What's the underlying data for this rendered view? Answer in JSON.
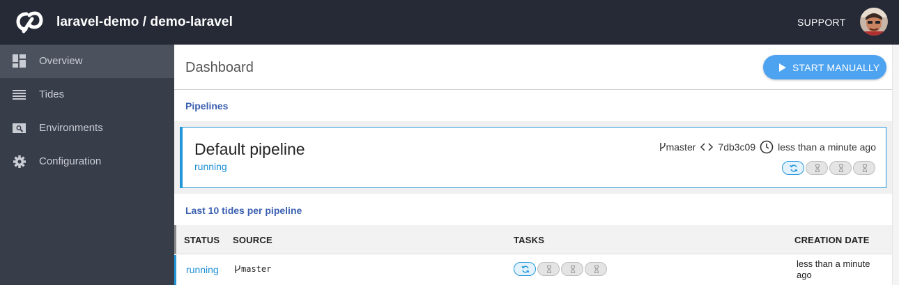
{
  "header": {
    "title": "laravel-demo / demo-laravel",
    "support_label": "SUPPORT"
  },
  "sidebar": {
    "items": [
      {
        "label": "Overview",
        "icon": "dashboard-icon",
        "active": true
      },
      {
        "label": "Tides",
        "icon": "list-icon",
        "active": false
      },
      {
        "label": "Environments",
        "icon": "environment-icon",
        "active": false
      },
      {
        "label": "Configuration",
        "icon": "gear-icon",
        "active": false
      }
    ]
  },
  "main": {
    "title": "Dashboard",
    "start_button_label": "START MANUALLY",
    "pipelines_section": "Pipelines",
    "tides_section": "Last 10 tides per pipeline"
  },
  "pipeline": {
    "name": "Default pipeline",
    "status": "running",
    "branch": "master",
    "commit": "7db3c09",
    "time": "less than a minute ago",
    "tasks": [
      "running",
      "pending",
      "pending",
      "pending"
    ]
  },
  "table": {
    "headers": [
      "STATUS",
      "SOURCE",
      "TASKS",
      "CREATION DATE"
    ],
    "rows": [
      {
        "status": "running",
        "source": "master",
        "tasks": [
          "running",
          "pending",
          "pending",
          "pending"
        ],
        "date": "less than a minute ago"
      }
    ]
  },
  "colors": {
    "topbar": "#252a36",
    "sidebar": "#383d4a",
    "accent": "#2196d8",
    "button": "#4da3f0",
    "link": "#3a5fb0"
  }
}
